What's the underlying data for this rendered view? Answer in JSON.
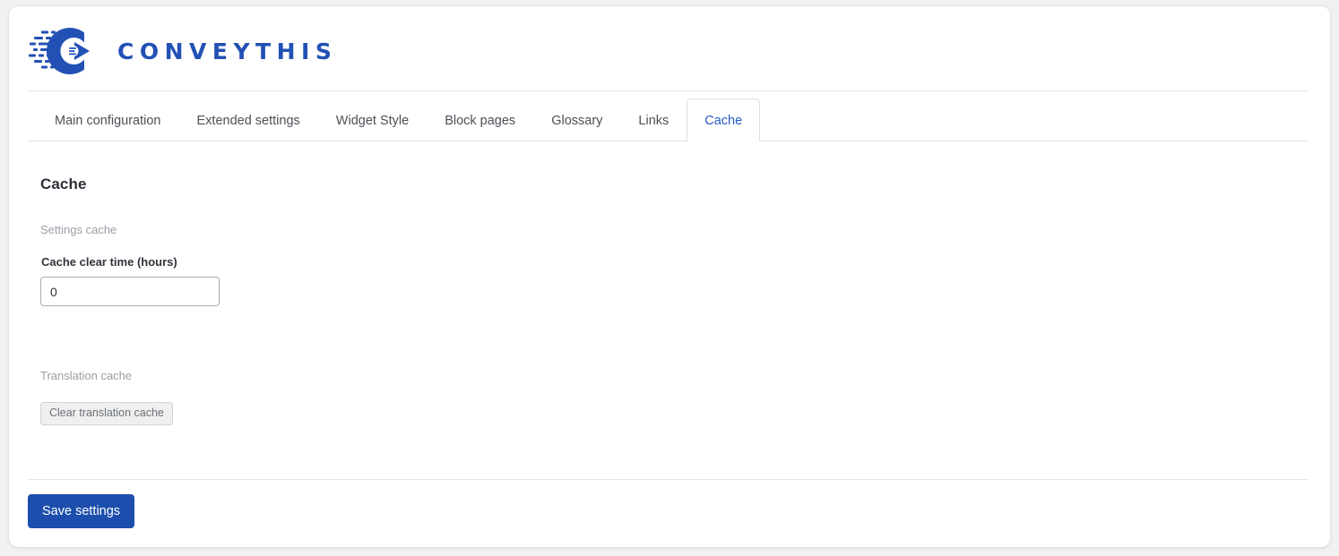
{
  "brand": {
    "wordmark": "CONVEYTHIS",
    "logo_icon": "conveythis-rocket-c-logo",
    "brand_color": "#2250b5"
  },
  "tabs": {
    "items": [
      {
        "label": "Main configuration",
        "active": false
      },
      {
        "label": "Extended settings",
        "active": false
      },
      {
        "label": "Widget Style",
        "active": false
      },
      {
        "label": "Block pages",
        "active": false
      },
      {
        "label": "Glossary",
        "active": false
      },
      {
        "label": "Links",
        "active": false
      },
      {
        "label": "Cache",
        "active": true
      }
    ],
    "active_label": "Cache",
    "active_color": "#2a5cc8"
  },
  "content": {
    "heading": "Cache",
    "settings_cache": {
      "caption": "Settings cache",
      "field_label": "Cache clear time (hours)",
      "field_value": "0",
      "field_placeholder": ""
    },
    "translation_cache": {
      "caption": "Translation cache",
      "button_label": "Clear translation cache"
    }
  },
  "footer": {
    "save_label": "Save settings",
    "save_color": "#1d4ead"
  }
}
